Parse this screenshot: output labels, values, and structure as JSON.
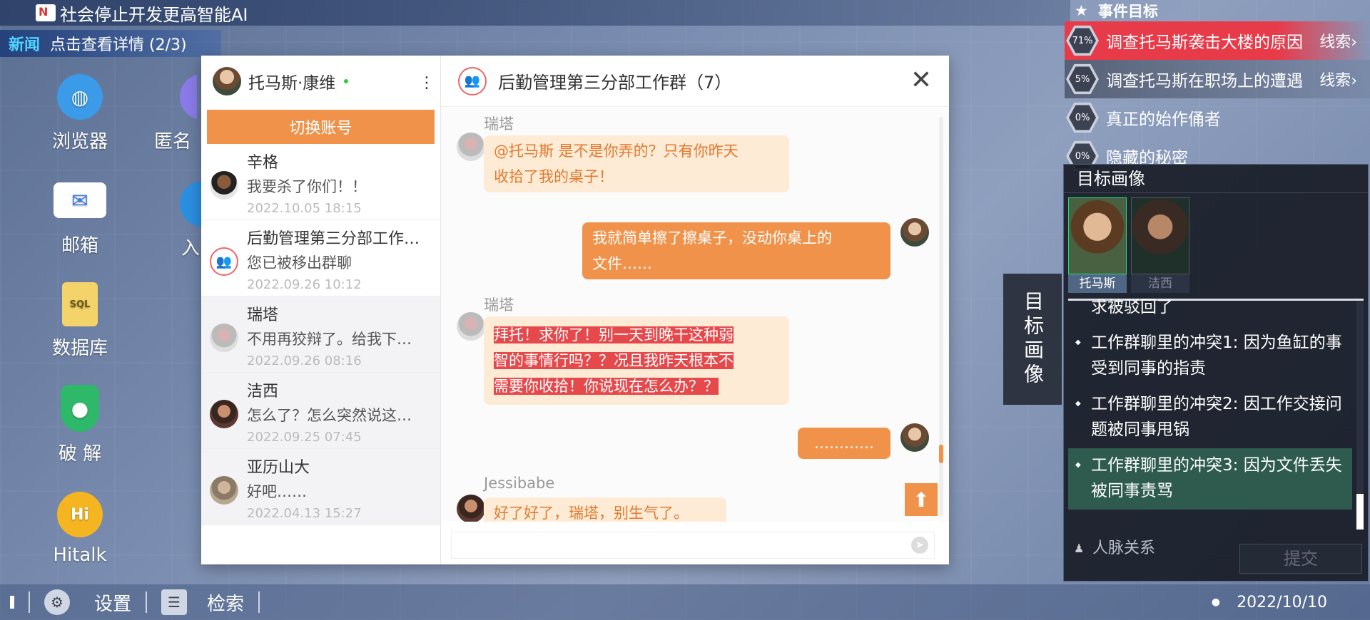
{
  "topbar": {
    "headline": "社会停止开发更高智能AI"
  },
  "news": {
    "tag": "新闻",
    "text": "点击查看详情 (2/3)"
  },
  "desktop_icons": [
    {
      "label": "浏览器",
      "icon": "globe-icon",
      "color": "#3c9be8"
    },
    {
      "label": "邮箱",
      "icon": "mail-icon",
      "color": "#3b7bea"
    },
    {
      "label": "数据库",
      "icon": "sql-file-icon",
      "color": "#f0c040"
    },
    {
      "label": "破 解",
      "icon": "shield-key-icon",
      "color": "#2eb86a"
    },
    {
      "label": "Hitalk",
      "icon": "hitalk-icon",
      "color": "#f5b521"
    }
  ],
  "desktop_icons_partial": [
    {
      "label": "匿名",
      "icon": "purple-app-icon"
    },
    {
      "label": "入",
      "icon": "blue-app-icon"
    }
  ],
  "chat": {
    "account_name": "托马斯·康维",
    "switch_label": "切换账号",
    "contacts": [
      {
        "name": "辛格",
        "msg": "我要杀了你们！！",
        "time": "2022.10.05 18:15",
        "type": "person"
      },
      {
        "name": "后勤管理第三分部工作…",
        "msg": "您已被移出群聊",
        "time": "2022.09.26 10:12",
        "type": "group"
      },
      {
        "name": "瑞塔",
        "msg": "不用再狡辩了。给我下…",
        "time": "2022.09.26 08:16",
        "type": "person"
      },
      {
        "name": "洁西",
        "msg": "怎么了？怎么突然说这…",
        "time": "2022.09.25 07:45",
        "type": "person"
      },
      {
        "name": "亚历山大",
        "msg": "好吧……",
        "time": "2022.04.13 15:27",
        "type": "person"
      }
    ],
    "group_title": "后勤管理第三分部工作群（7）",
    "messages": [
      {
        "sender": "瑞塔",
        "text1": "@托马斯 是不是你弄的？只有你昨天",
        "text2": "收拾了我的桌子！"
      },
      {
        "sender": "",
        "text1": "我就简单擦了擦桌子，没动你桌上的",
        "text2": "文件……"
      },
      {
        "sender": "瑞塔",
        "text1": "拜托！求你了！别一天到晚干这种弱",
        "text2": "智的事情行吗？？况且我昨天根本不",
        "text3": "需要你收拾！你说现在怎么办？？"
      },
      {
        "sender": "",
        "text1": "…………"
      },
      {
        "sender": "Jessibabe",
        "text1": "好了好了，瑞塔，别生气了。"
      }
    ]
  },
  "goals": {
    "title": "事件目标",
    "items": [
      {
        "pct": "71%",
        "text": "调查托马斯袭击大楼的原因",
        "clue": "线索›"
      },
      {
        "pct": "5%",
        "text": "调查托马斯在职场上的遭遇",
        "clue": "线索›"
      },
      {
        "pct": "0%",
        "text": "真正的始作俑者",
        "clue": ""
      },
      {
        "pct": "0%",
        "text": "隐藏的秘密",
        "clue": ""
      }
    ]
  },
  "portrait_panel": {
    "title": "目标画像",
    "side_tab": "目标画像",
    "portraits": [
      {
        "name": "托马斯"
      },
      {
        "name": "洁西"
      }
    ],
    "notes": [
      {
        "text": "求被驳回了"
      },
      {
        "text": "工作群聊里的冲突1: 因为鱼缸的事受到同事的指责"
      },
      {
        "text": "工作群聊里的冲突2: 因工作交接问题被同事甩锅"
      },
      {
        "text": "工作群聊里的冲突3: 因为文件丢失被同事责骂"
      }
    ],
    "relations": "人脉关系",
    "submit": "提交"
  },
  "taskbar": {
    "settings": "设置",
    "search": "检索",
    "date": "2022/10/10"
  }
}
